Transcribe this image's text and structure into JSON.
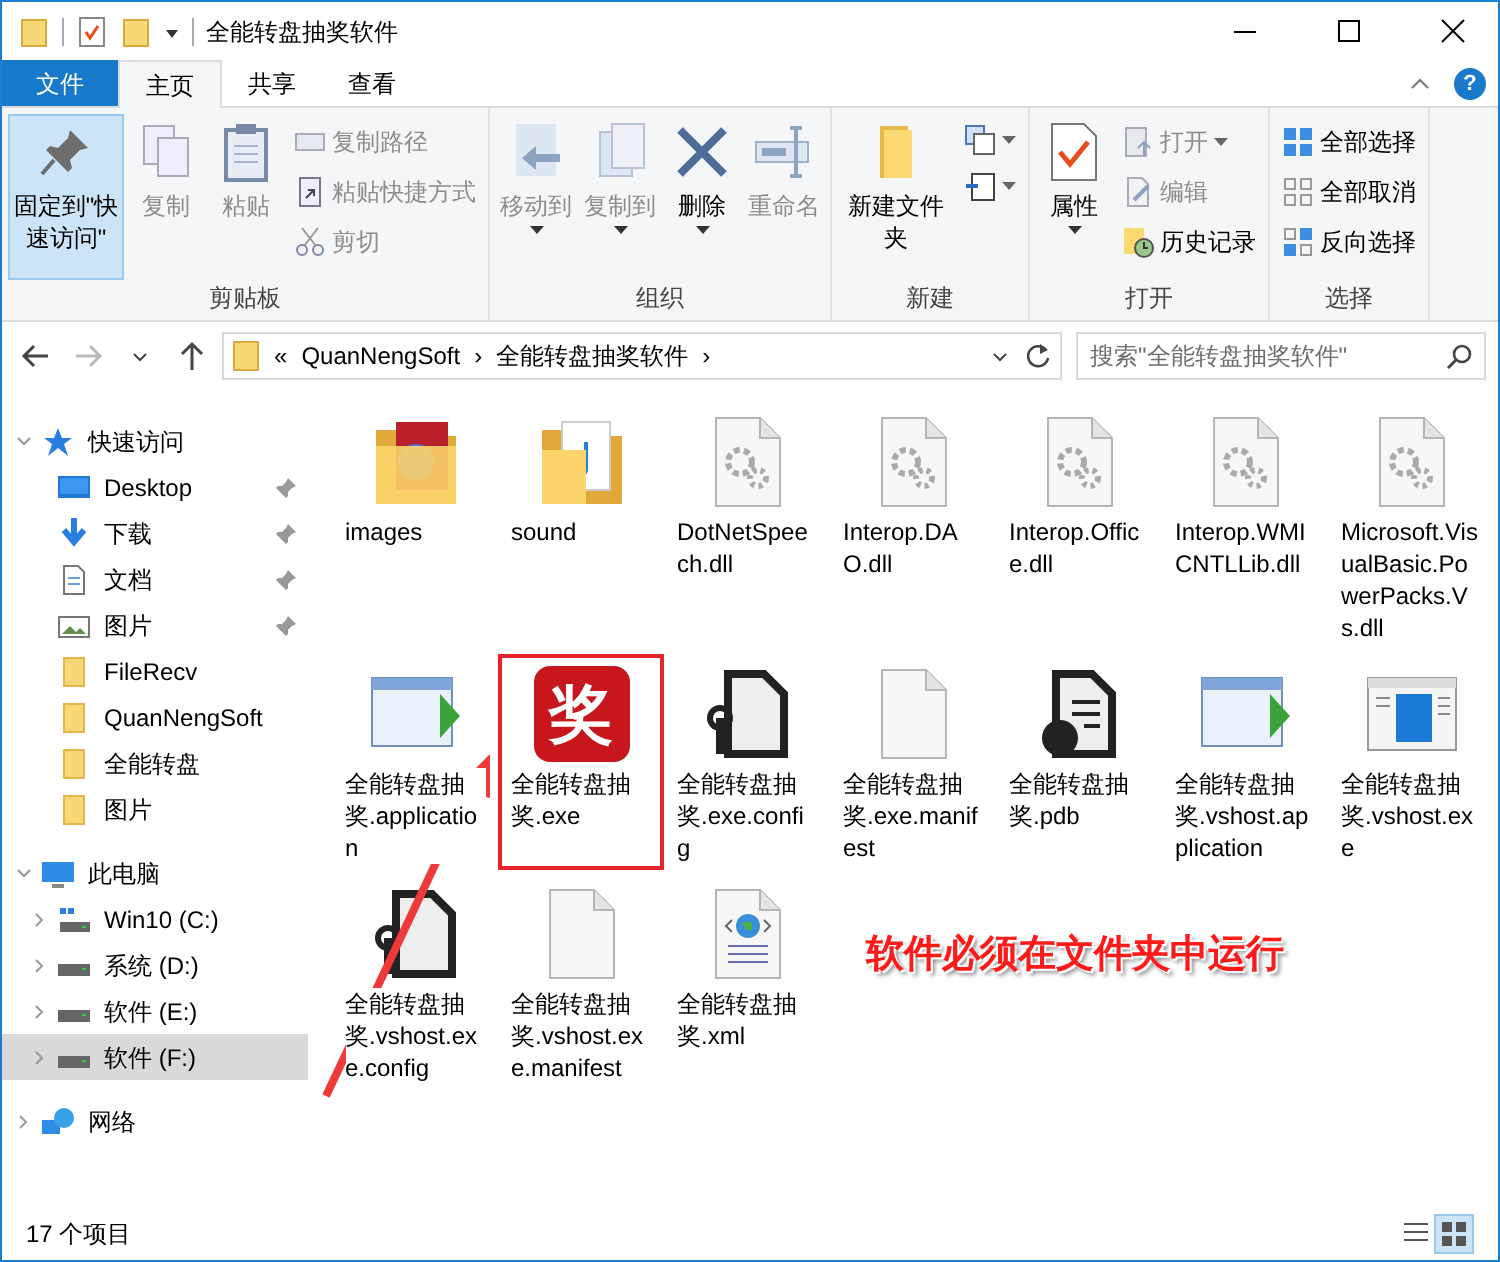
{
  "window": {
    "title": "全能转盘抽奖软件",
    "controls": [
      {
        "kind": "minimize"
      },
      {
        "kind": "maximize"
      },
      {
        "kind": "close"
      }
    ]
  },
  "ribbon": {
    "tabs": [
      {
        "label": "文件",
        "kind": "file",
        "selected": false
      },
      {
        "label": "主页",
        "kind": "tab",
        "selected": true
      },
      {
        "label": "共享",
        "kind": "tab",
        "selected": false
      },
      {
        "label": "查看",
        "kind": "tab",
        "selected": false
      }
    ],
    "help": "?",
    "groups": [
      {
        "label": "剪贴板",
        "items": [
          {
            "kind": "large",
            "label": "固定到\"快速访问\"",
            "disabled": false,
            "selected": true
          },
          {
            "kind": "large",
            "label": "复制",
            "disabled": true,
            "selected": false
          },
          {
            "kind": "large",
            "label": "粘贴",
            "disabled": true,
            "selected": false
          },
          {
            "kind": "small",
            "label": "复制路径",
            "disabled": true,
            "selected": false
          },
          {
            "kind": "small",
            "label": "粘贴快捷方式",
            "disabled": true,
            "selected": false
          },
          {
            "kind": "small",
            "label": "剪切",
            "disabled": true,
            "selected": false
          }
        ]
      },
      {
        "label": "组织",
        "items": [
          {
            "kind": "large",
            "label": "移动到",
            "disabled": true,
            "dropdown": true,
            "selected": false
          },
          {
            "kind": "large",
            "label": "复制到",
            "disabled": true,
            "dropdown": true,
            "selected": false
          },
          {
            "kind": "large",
            "label": "删除",
            "disabled": false,
            "dropdown": true,
            "selected": false
          },
          {
            "kind": "large",
            "label": "重命名",
            "disabled": true,
            "selected": false
          }
        ]
      },
      {
        "label": "新建",
        "items": [
          {
            "kind": "large",
            "label": "新建文件夹",
            "disabled": false,
            "selected": false
          },
          {
            "kind": "small",
            "disabled": false,
            "dropdown": true,
            "selected": false
          },
          {
            "kind": "small",
            "disabled": false,
            "dropdown": true,
            "selected": false
          }
        ]
      },
      {
        "label": "打开",
        "items": [
          {
            "kind": "large",
            "label": "属性",
            "disabled": false,
            "dropdown": true,
            "selected": false
          },
          {
            "kind": "small",
            "label": "打开",
            "disabled": true,
            "dropdown": true,
            "selected": false
          },
          {
            "kind": "small",
            "label": "编辑",
            "disabled": true,
            "selected": false
          },
          {
            "kind": "small",
            "label": "历史记录",
            "disabled": false,
            "selected": false
          }
        ]
      },
      {
        "label": "选择",
        "items": [
          {
            "kind": "small",
            "label": "全部选择",
            "disabled": false,
            "selected": false
          },
          {
            "kind": "small",
            "label": "全部取消",
            "disabled": false,
            "selected": false
          },
          {
            "kind": "small",
            "label": "反向选择",
            "disabled": false,
            "selected": false
          }
        ]
      }
    ]
  },
  "address_bar": {
    "back_disabled": false,
    "forward_disabled": true,
    "overflow": "«",
    "crumbs": [
      {
        "label": "QuanNengSoft",
        "separator": "›"
      },
      {
        "label": "全能转盘抽奖软件",
        "separator": "›"
      }
    ],
    "search": {
      "placeholder": "搜索\"全能转盘抽奖软件\""
    }
  },
  "sidebar": [
    {
      "label": "快速访问",
      "kind": "quick",
      "expanded": true,
      "selected": false,
      "children": [
        {
          "label": "Desktop",
          "kind": "desktop",
          "pinned": true,
          "selected": false
        },
        {
          "label": "下载",
          "kind": "download",
          "pinned": true,
          "selected": false
        },
        {
          "label": "文档",
          "kind": "document",
          "pinned": true,
          "selected": false
        },
        {
          "label": "图片",
          "kind": "picture",
          "pinned": true,
          "selected": false
        },
        {
          "label": "FileRecv",
          "kind": "folder",
          "pinned": false,
          "selected": false
        },
        {
          "label": "QuanNengSoft",
          "kind": "folder",
          "pinned": false,
          "selected": false
        },
        {
          "label": "全能转盘",
          "kind": "folder",
          "pinned": false,
          "selected": false
        },
        {
          "label": "图片",
          "kind": "folder",
          "pinned": false,
          "selected": false
        }
      ]
    },
    {
      "label": "此电脑",
      "kind": "pc",
      "expanded": true,
      "selected": false,
      "children": [
        {
          "label": "Win10 (C:)",
          "kind": "system-drive",
          "expanded": false,
          "selected": false
        },
        {
          "label": "系统 (D:)",
          "kind": "drive",
          "expanded": false,
          "selected": false
        },
        {
          "label": "软件 (E:)",
          "kind": "drive",
          "expanded": false,
          "selected": false
        },
        {
          "label": "软件 (F:)",
          "kind": "drive",
          "expanded": false,
          "selected": true
        }
      ]
    },
    {
      "label": "网络",
      "kind": "network",
      "expanded": false,
      "selected": false
    }
  ],
  "files": [
    {
      "name": "images",
      "kind": "folder-images",
      "boxed": false
    },
    {
      "name": "sound",
      "kind": "folder-sound",
      "boxed": false
    },
    {
      "name": "DotNetSpeech.dll",
      "kind": "dll",
      "boxed": false
    },
    {
      "name": "Interop.DAO.dll",
      "kind": "dll",
      "boxed": false
    },
    {
      "name": "Interop.Office.dll",
      "kind": "dll",
      "boxed": false
    },
    {
      "name": "Interop.WMICNTLLib.dll",
      "kind": "dll",
      "boxed": false
    },
    {
      "name": "Microsoft.VisualBasic.PowerPacks.Vs.dll",
      "kind": "dll",
      "boxed": false
    },
    {
      "name": "全能转盘抽奖.application",
      "kind": "application",
      "boxed": false
    },
    {
      "name": "全能转盘抽奖.exe",
      "kind": "exe",
      "icon_text": "奖",
      "boxed": true
    },
    {
      "name": "全能转盘抽奖.exe.config",
      "kind": "config",
      "boxed": false
    },
    {
      "name": "全能转盘抽奖.exe.manifest",
      "kind": "manifest",
      "boxed": false
    },
    {
      "name": "全能转盘抽奖.pdb",
      "kind": "pdb",
      "boxed": false
    },
    {
      "name": "全能转盘抽奖.vshost.application",
      "kind": "application",
      "boxed": false
    },
    {
      "name": "全能转盘抽奖.vshost.exe",
      "kind": "vshost",
      "boxed": false
    },
    {
      "name": "全能转盘抽奖.vshost.exe.config",
      "kind": "config",
      "boxed": false
    },
    {
      "name": "全能转盘抽奖.vshost.exe.manifest",
      "kind": "manifest",
      "boxed": false
    },
    {
      "name": "全能转盘抽奖.xml",
      "kind": "xml",
      "boxed": false
    }
  ],
  "annotation": {
    "text": "软件必须在文件夹中运行",
    "arrow": true
  },
  "status_bar": {
    "count": "17 个项目",
    "views": [
      {
        "kind": "details",
        "selected": false
      },
      {
        "kind": "icons",
        "selected": true
      }
    ]
  }
}
